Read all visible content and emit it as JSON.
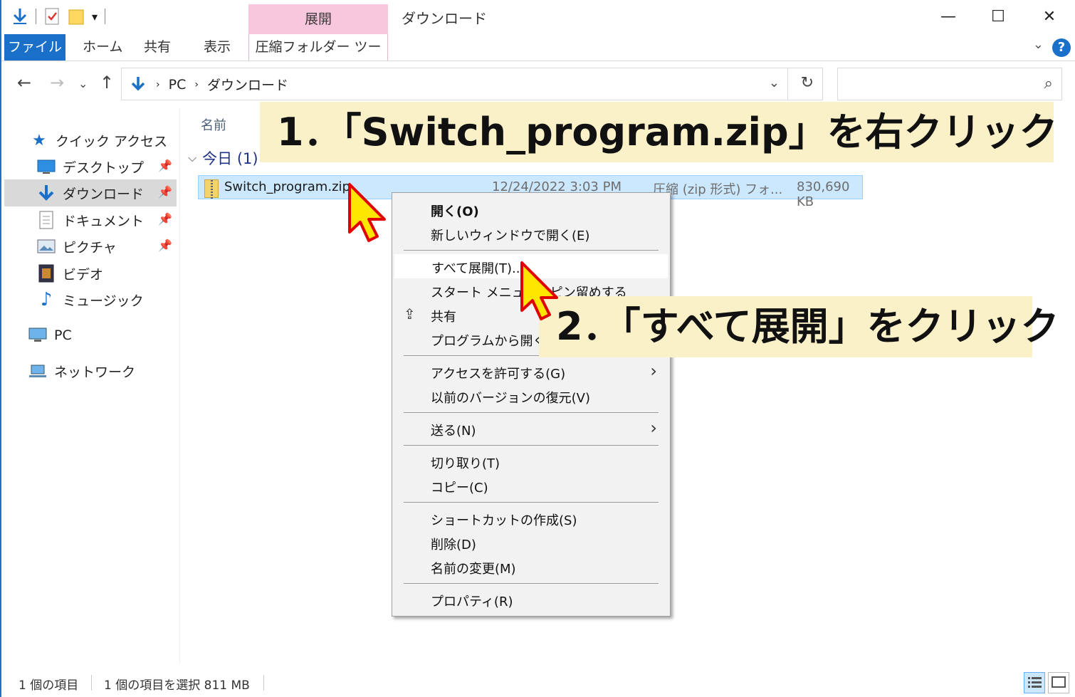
{
  "window": {
    "title": "ダウンロード",
    "context_tab_group": "展開",
    "controls": {
      "minimize": "—",
      "maximize": "☐",
      "close": "✕"
    }
  },
  "ribbon": {
    "tabs": [
      "ファイル",
      "ホーム",
      "共有",
      "表示",
      "圧縮フォルダー ツール"
    ],
    "help": "?"
  },
  "address": {
    "path": [
      "PC",
      "ダウンロード"
    ],
    "search_placeholder": ""
  },
  "sidebar": {
    "items": [
      {
        "label": "クイック アクセス",
        "icon": "star-icon"
      },
      {
        "label": "デスクトップ",
        "icon": "desktop-icon",
        "pinned": true
      },
      {
        "label": "ダウンロード",
        "icon": "download-icon",
        "pinned": true,
        "selected": true
      },
      {
        "label": "ドキュメント",
        "icon": "document-icon",
        "pinned": true
      },
      {
        "label": "ピクチャ",
        "icon": "picture-icon",
        "pinned": true
      },
      {
        "label": "ビデオ",
        "icon": "video-icon"
      },
      {
        "label": "ミュージック",
        "icon": "music-icon"
      },
      {
        "label": "PC",
        "icon": "pc-icon"
      },
      {
        "label": "ネットワーク",
        "icon": "network-icon"
      }
    ]
  },
  "content": {
    "column_name": "名前",
    "group": "今日 (1)",
    "file": {
      "name": "Switch_program.zip",
      "date": "12/24/2022 3:03 PM",
      "type": "圧縮 (zip 形式) フォ...",
      "size": "830,690 KB"
    }
  },
  "context_menu": {
    "items": [
      "開く(O)",
      "新しいウィンドウで開く(E)",
      "すべて展開(T)...",
      "スタート メニューにピン留めする",
      "共有",
      "プログラムから開く(H)",
      "アクセスを許可する(G)",
      "以前のバージョンの復元(V)",
      "送る(N)",
      "切り取り(T)",
      "コピー(C)",
      "ショートカットの作成(S)",
      "削除(D)",
      "名前の変更(M)",
      "プロパティ(R)"
    ]
  },
  "callouts": {
    "step1": "1．「Switch_program.zip」を右クリック",
    "step2": "2．「すべて展開」をクリック"
  },
  "status": {
    "item_count": "1 個の項目",
    "selection": "1 個の項目を選択  811 MB"
  },
  "colors": {
    "accent": "#1a6fc9",
    "context_tab": "#f9c7dd",
    "selection": "#cce8ff",
    "callout_bg": "#fbf1c8",
    "cursor": "#ffe600"
  }
}
